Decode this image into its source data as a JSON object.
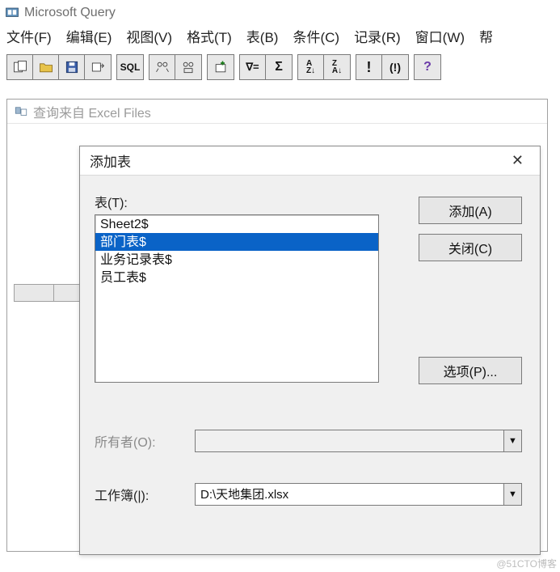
{
  "app": {
    "title": "Microsoft Query"
  },
  "menu": {
    "file": "文件(F)",
    "edit": "编辑(E)",
    "view": "视图(V)",
    "format": "格式(T)",
    "table": "表(B)",
    "criteria": "条件(C)",
    "records": "记录(R)",
    "window": "窗口(W)",
    "help": "帮"
  },
  "toolbar_labels": {
    "sql": "SQL",
    "filter_prefix": "∇",
    "filter_eq": "=",
    "sigma": "Σ",
    "sort_az_a": "A",
    "sort_az_z": "Z",
    "sort_za_z": "Z",
    "sort_za_a": "A",
    "exclaim": "!",
    "paren_exclaim": "(!)",
    "question": "?"
  },
  "child": {
    "title": "查询来自 Excel Files"
  },
  "dialog": {
    "title": "添加表",
    "close_x": "✕",
    "table_label": "表(T):",
    "items": [
      "Sheet2$",
      "部门表$",
      "业务记录表$",
      "员工表$"
    ],
    "selected_index": 1,
    "buttons": {
      "add": "添加(A)",
      "close": "关闭(C)",
      "options": "选项(P)..."
    },
    "owner_label": "所有者(O):",
    "owner_value": "",
    "workbook_label": "工作簿(|):",
    "workbook_value": "D:\\天地集团.xlsx"
  },
  "watermark": "@51CTO博客"
}
